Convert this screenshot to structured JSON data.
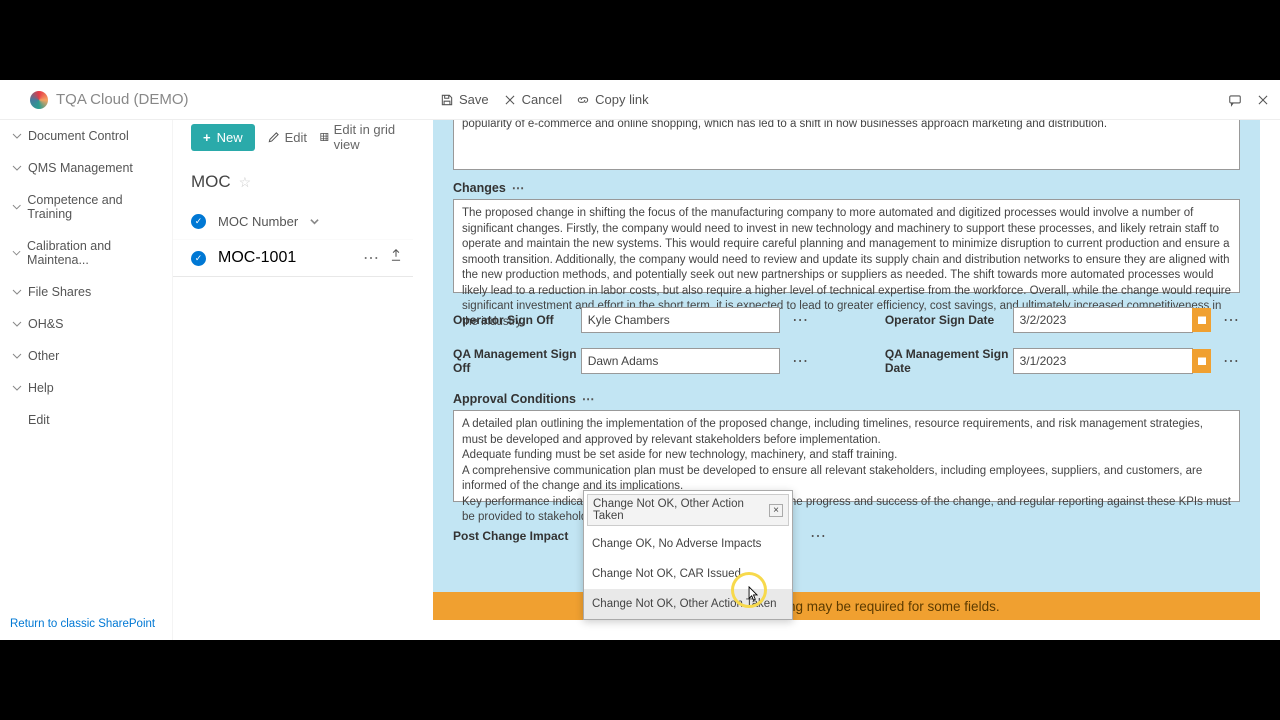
{
  "brand": "TQA Cloud (DEMO)",
  "top_actions": {
    "save": "Save",
    "cancel": "Cancel",
    "copylink": "Copy link"
  },
  "sidebar": {
    "items": [
      "Document Control",
      "QMS Management",
      "Competence and Training",
      "Calibration and Maintena...",
      "File Shares",
      "OH&S",
      "Other",
      "Help"
    ],
    "edit": "Edit",
    "footer": "Return to classic SharePoint"
  },
  "middle": {
    "new": "New",
    "edit": "Edit",
    "grid": "Edit in grid view",
    "title": "MOC",
    "col": "MOC Number",
    "row": "MOC-1001"
  },
  "form": {
    "truncated_top": "increasing demand for sustainable and eco-friendly products, as consumers become more environmentally conscious. Another trend is the growing popularity of e-commerce and online shopping, which has led to a shift in how businesses approach marketing and distribution.",
    "changes_label": "Changes",
    "changes_text": "The proposed change in shifting the focus of the manufacturing company to more automated and digitized processes would involve a number of significant changes. Firstly, the company would need to invest in new technology and machinery to support these processes, and likely retrain staff to operate and maintain the new systems. This would require careful planning and management to minimize disruption to current production and ensure a smooth transition. Additionally, the company would need to review and update its supply chain and distribution networks to ensure they are aligned with the new production methods, and potentially seek out new partnerships or suppliers as needed. The shift towards more automated processes would likely lead to a reduction in labor costs, but also require a higher level of technical expertise from the workforce. Overall, while the change would require significant investment and effort in the short term, it is expected to lead to greater efficiency, cost savings, and ultimately increased competitiveness in the industry.",
    "operator_label": "Operator Sign Off",
    "operator_value": "Kyle Chambers",
    "operator_date_label": "Operator Sign Date",
    "operator_date_value": "3/2/2023",
    "qa_label": "QA Management Sign Off",
    "qa_value": "Dawn Adams",
    "qa_date_label": "QA Management Sign Date",
    "qa_date_value": "3/1/2023",
    "approval_label": "Approval Conditions",
    "approval_text": "A detailed plan outlining the implementation of the proposed change, including timelines, resource requirements, and risk management strategies, must be developed and approved by relevant stakeholders before implementation.\nAdequate funding must be set aside for new technology, machinery, and staff training.\nA comprehensive communication plan must be developed to ensure all relevant stakeholders, including employees, suppliers, and customers, are informed of the change and its implications.\nKey performance indicators (KPIs) must be established to track the progress and success of the change, and regular reporting against these KPIs must be provided to stakeholders.",
    "post_change_label": "Post Change Impact",
    "dropdown": {
      "selected": "Change Not OK, Other Action Taken",
      "options": [
        "Change OK, No Adverse Impacts",
        "Change Not OK, CAR Issued",
        "Change Not OK, Other Action Taken"
      ]
    },
    "orange_note": "Additonal scrolling may be required for some fields."
  }
}
